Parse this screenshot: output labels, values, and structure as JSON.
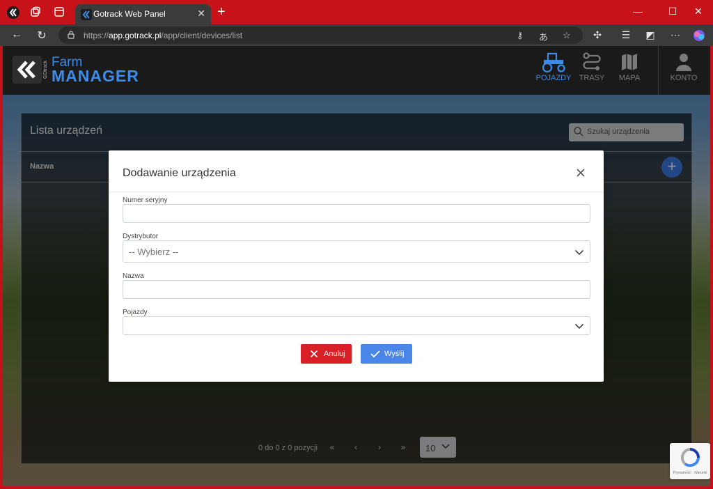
{
  "browser": {
    "tab_title": "Gotrack Web Panel",
    "url_scheme": "https://",
    "url_host": "app.gotrack.pl",
    "url_path": "/app/client/devices/list"
  },
  "app": {
    "logo_brand": "GOtrack",
    "logo_farm": "Farm",
    "logo_manager": "MANAGER",
    "nav": [
      {
        "label": "POJAZDY",
        "icon": "tractor-icon",
        "active": true
      },
      {
        "label": "TRASY",
        "icon": "route-icon",
        "active": false
      },
      {
        "label": "MAPA",
        "icon": "map-icon",
        "active": false
      },
      {
        "label": "KONTO",
        "icon": "user-icon",
        "active": false
      }
    ]
  },
  "list": {
    "title": "Lista urządzeń",
    "search_placeholder": "Szukaj urządzenia",
    "column_name": "Nazwa",
    "add_label": "+",
    "pager_info": "0 do 0 z 0 pozycji",
    "page_size": "10"
  },
  "modal": {
    "title": "Dodawanie urządzenia",
    "serial_label": "Numer seryjny",
    "serial_value": "",
    "distributor_label": "Dystrybutor",
    "distributor_value": "-- Wybierz --",
    "name_label": "Nazwa",
    "name_value": "",
    "vehicles_label": "Pojazdy",
    "vehicles_value": "",
    "cancel_label": "Anuluj",
    "send_label": "Wyślij"
  },
  "recaptcha": {
    "text": "Prywatność - Warunki"
  },
  "colors": {
    "accent": "#3d8be6",
    "cancel": "#d81f26",
    "send": "#4a86e8",
    "frame": "#c8121a"
  }
}
